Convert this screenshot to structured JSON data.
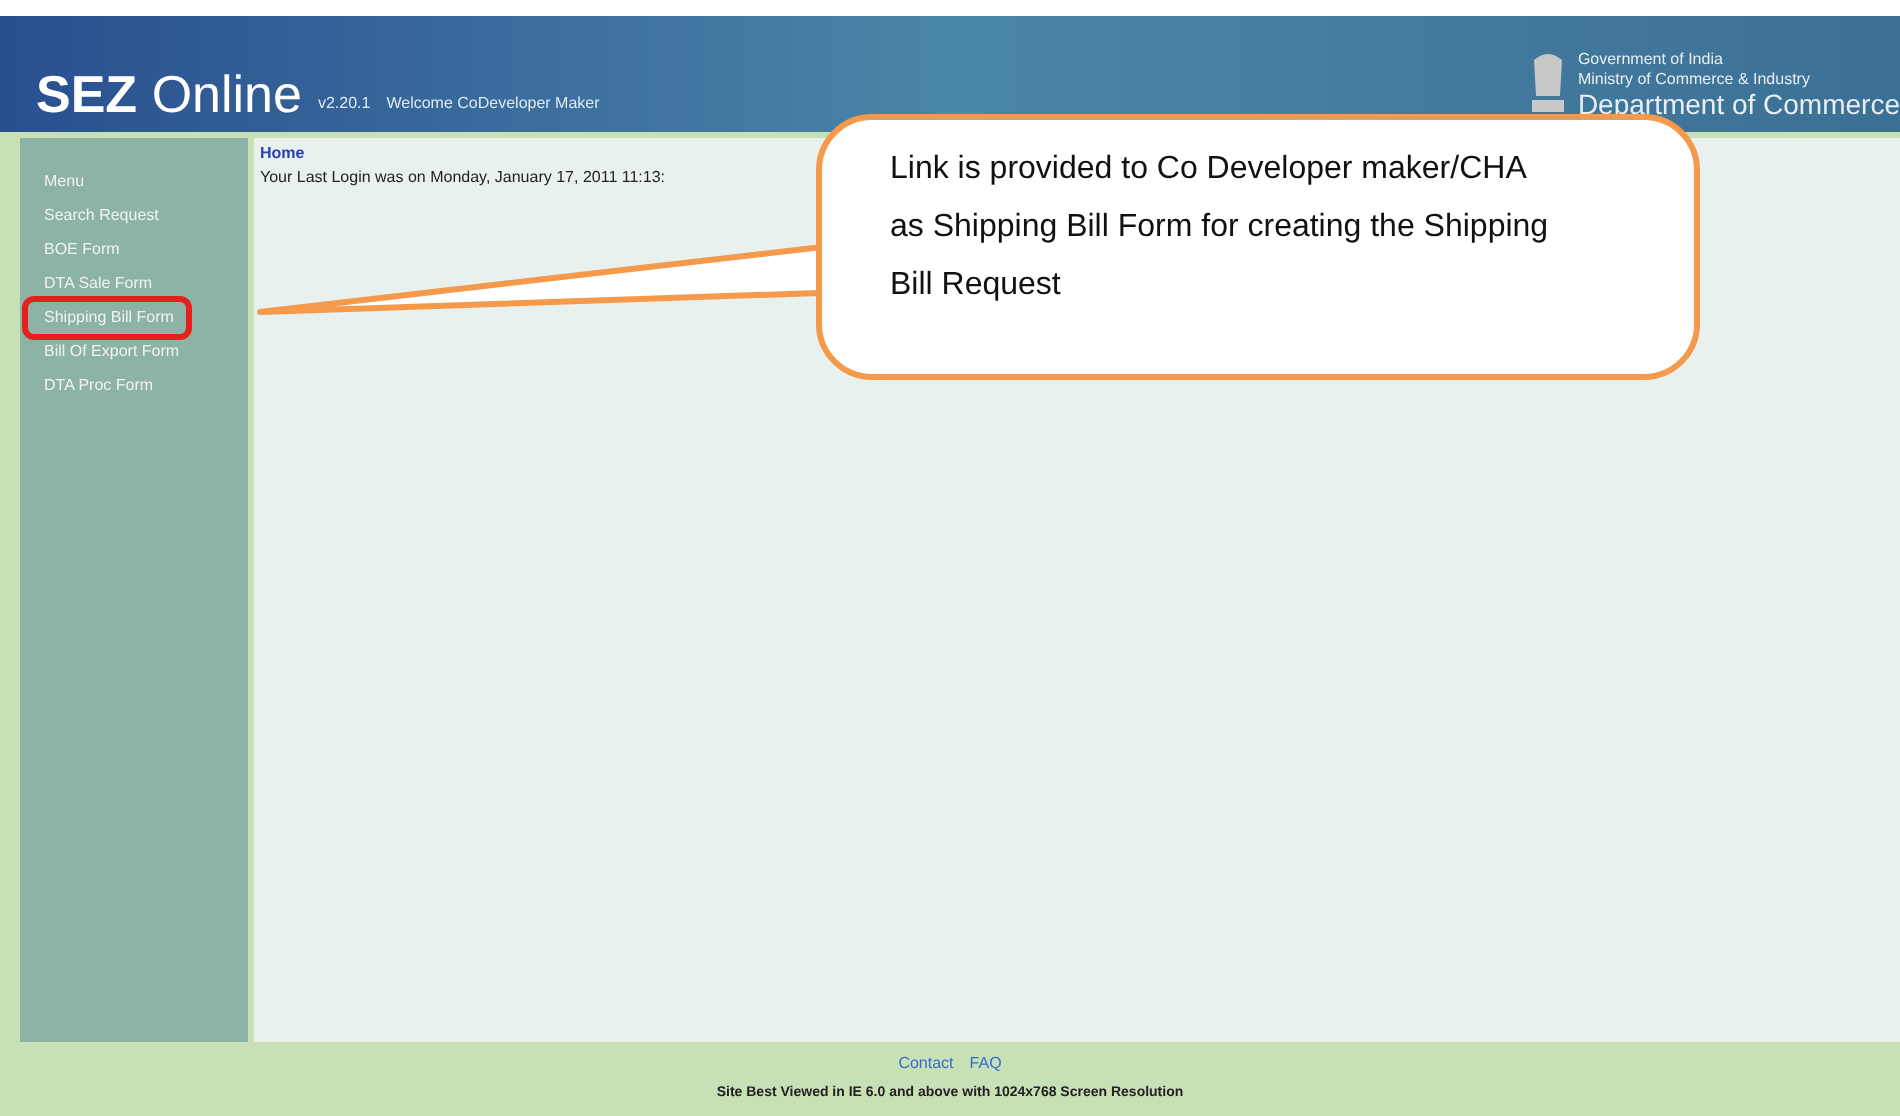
{
  "header": {
    "logo_bold": "SEZ",
    "logo_light": "Online",
    "version": "v2.20.1",
    "welcome": "Welcome CoDeveloper Maker",
    "emblem_lines": [
      "Government of India",
      "Ministry of Commerce & Industry"
    ],
    "department": "Department of Commerce"
  },
  "sidebar": {
    "items": [
      {
        "label": "Menu",
        "selected": false
      },
      {
        "label": "Search Request",
        "selected": false
      },
      {
        "label": "BOE Form",
        "selected": false
      },
      {
        "label": "DTA Sale Form",
        "selected": false
      },
      {
        "label": "Shipping Bill Form",
        "selected": true
      },
      {
        "label": "Bill Of Export Form",
        "selected": false
      },
      {
        "label": "DTA Proc Form",
        "selected": false
      }
    ]
  },
  "content": {
    "breadcrumb": "Home",
    "last_login": "Your Last Login was on Monday, January 17, 2011 11:13:"
  },
  "callout": {
    "text": "Link is provided to Co Developer maker/CHA as Shipping Bill Form for creating the Shipping Bill Request"
  },
  "footer": {
    "links": [
      "Contact",
      "FAQ"
    ],
    "note": "Site Best Viewed in IE 6.0 and above with 1024x768 Screen Resolution"
  }
}
